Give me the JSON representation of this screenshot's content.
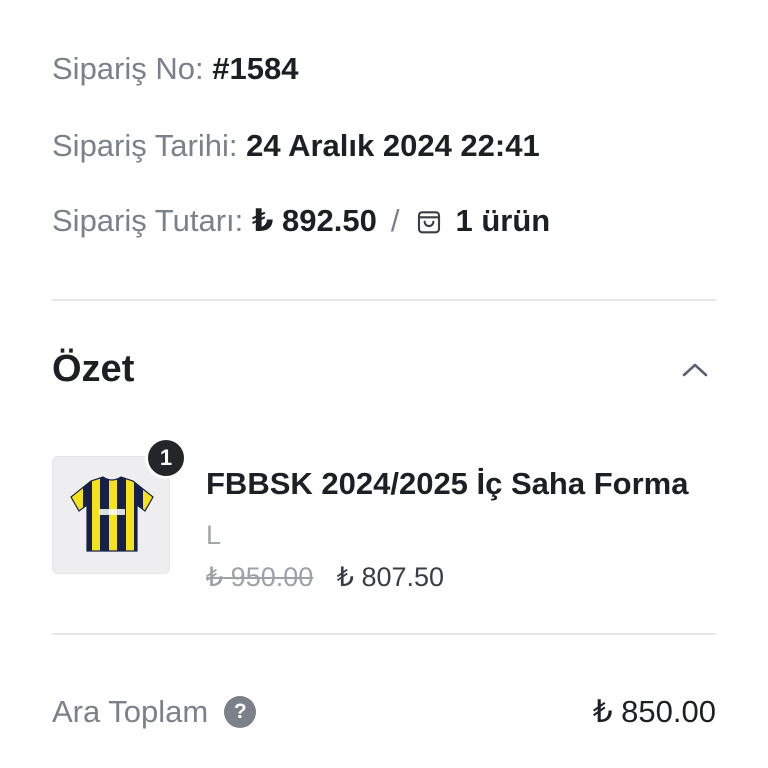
{
  "order": {
    "number_label": "Sipariş No:",
    "number_value": "#1584",
    "date_label": "Sipariş Tarihi:",
    "date_value": "24 Aralık 2024 22:41",
    "total_label": "Sipariş Tutarı:",
    "total_value": "₺ 892.50",
    "separator": "/",
    "item_count": "1 ürün"
  },
  "summary": {
    "title": "Özet",
    "item": {
      "quantity": "1",
      "name": "FBBSK 2024/2025 İç Saha Forma",
      "variant": "L",
      "old_price": "₺ 950.00",
      "price": "₺ 807.50",
      "jersey_colors": [
        "#f5e21a",
        "#16204a"
      ]
    },
    "subtotal_label": "Ara Toplam",
    "help_glyph": "?",
    "subtotal_value": "₺ 850.00"
  },
  "icons": {
    "bag": "shopping-bag-icon",
    "collapse": "chevron-up-icon",
    "help": "question-circle-icon"
  }
}
